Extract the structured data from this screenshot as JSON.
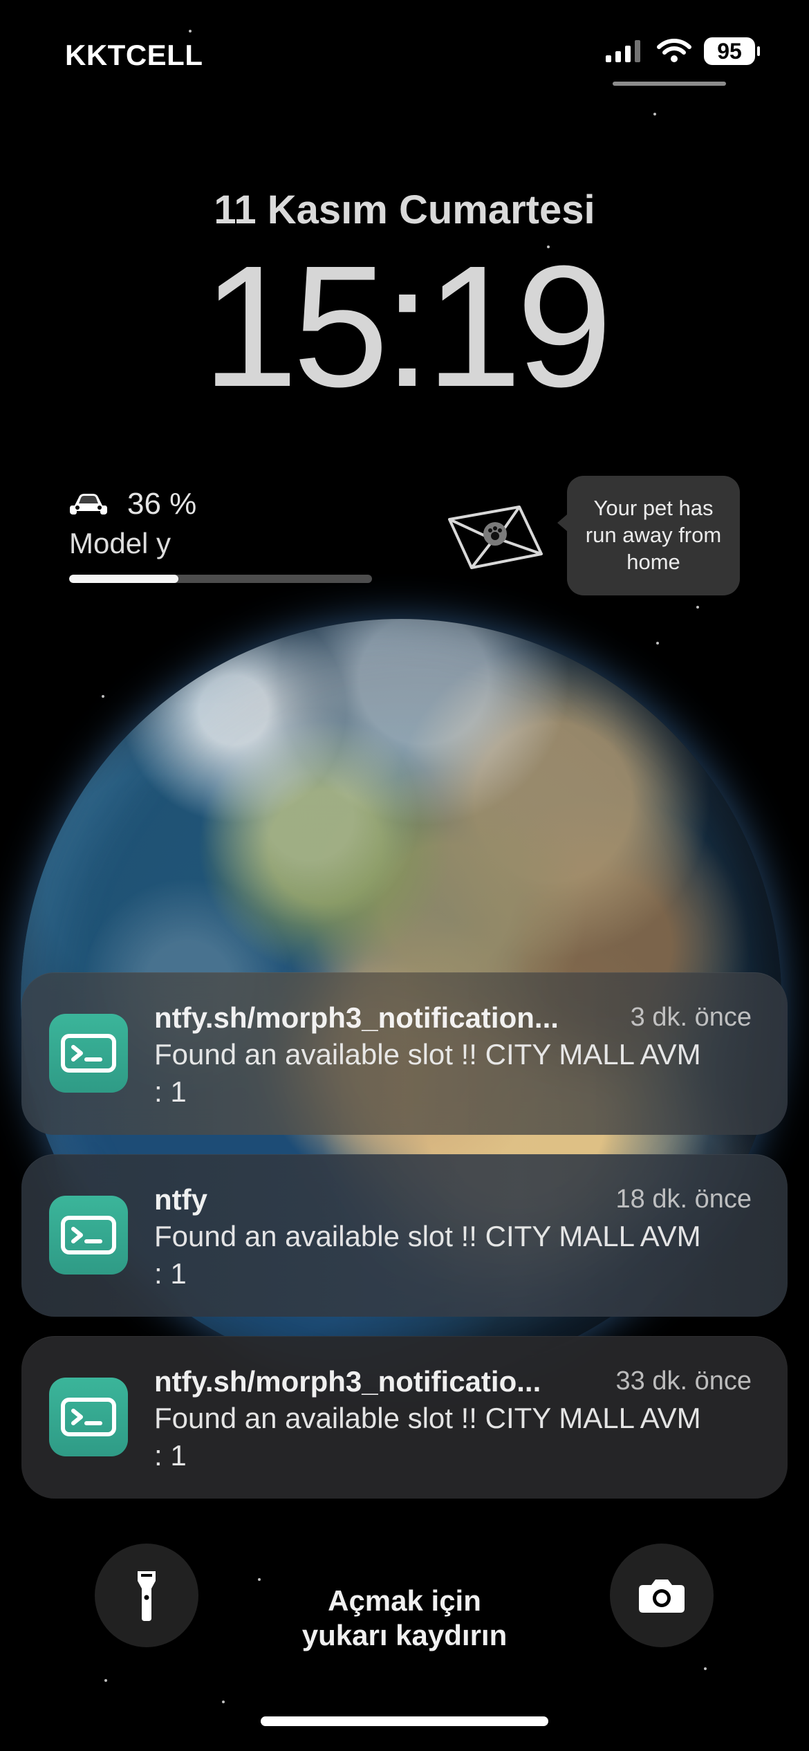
{
  "status_bar": {
    "carrier": "KKTCELL",
    "battery_level": "95"
  },
  "lock_screen": {
    "date": "11 Kasım Cumartesi",
    "time": "15:19"
  },
  "car_widget": {
    "percent": "36 %",
    "model": "Model y",
    "progress": 36
  },
  "pet_widget": {
    "message": "Your pet has run away from home"
  },
  "notifications": [
    {
      "title": "ntfy.sh/morph3_notification...",
      "time": "3 dk. önce",
      "body": "Found an available slot !! CITY MALL AVM : 1"
    },
    {
      "title": "ntfy",
      "time": "18 dk. önce",
      "body": "Found an available slot !! CITY MALL AVM : 1"
    },
    {
      "title": "ntfy.sh/morph3_notificatio...",
      "time": "33 dk. önce",
      "body": "Found an available slot !! CITY MALL AVM : 1"
    }
  ],
  "bottom": {
    "unlock_line1": "Açmak için",
    "unlock_line2": "yukarı kaydırın"
  },
  "colors": {
    "app_icon": "#3bb59a"
  }
}
